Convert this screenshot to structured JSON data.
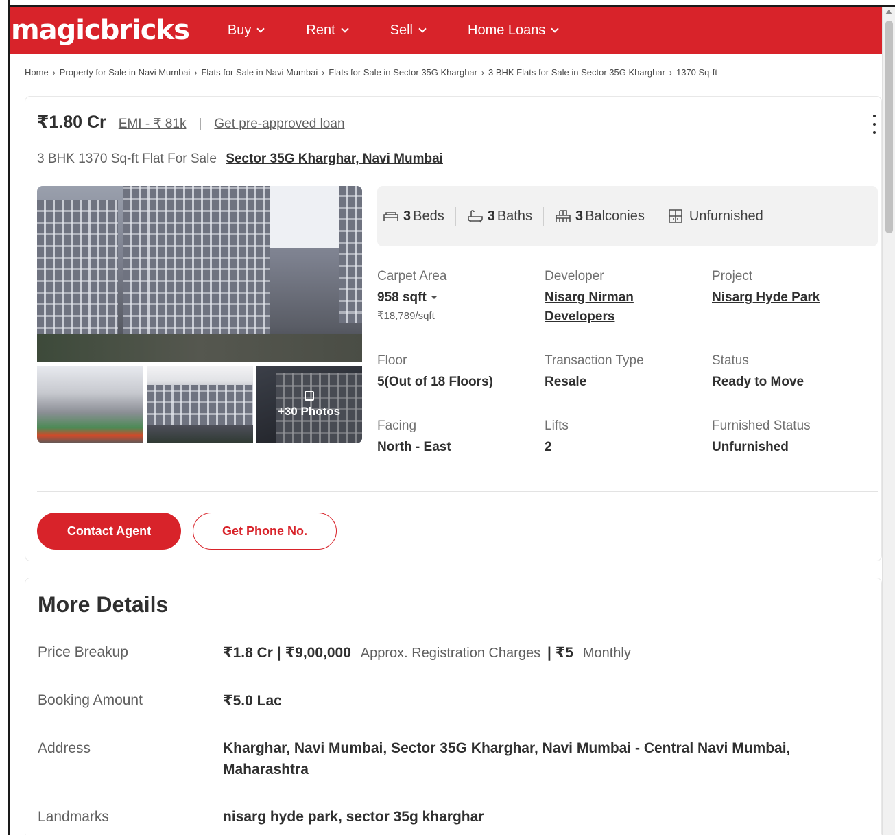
{
  "nav": {
    "logo": "magicbricks",
    "items": [
      {
        "label": "Buy"
      },
      {
        "label": "Rent"
      },
      {
        "label": "Sell"
      },
      {
        "label": "Home Loans"
      }
    ]
  },
  "breadcrumb": [
    "Home",
    "Property for Sale in Navi Mumbai",
    "Flats for Sale in Navi Mumbai",
    "Flats for Sale in Sector 35G Kharghar",
    "3 BHK Flats for Sale in Sector 35G Kharghar",
    "1370 Sq-ft"
  ],
  "listing": {
    "price": "₹1.80 Cr",
    "emi": "EMI - ₹ 81k",
    "separator": "|",
    "loan_link": "Get pre-approved loan",
    "subtitle": "3 BHK 1370 Sq-ft Flat For Sale",
    "location": "Sector 35G Kharghar, Navi Mumbai",
    "photos_more": "+30 Photos",
    "amenities": [
      {
        "count": "3",
        "label": "Beds",
        "icon": "bed-icon"
      },
      {
        "count": "3",
        "label": "Baths",
        "icon": "bathtub-icon"
      },
      {
        "count": "3",
        "label": "Balconies",
        "icon": "balcony-icon"
      },
      {
        "count": "",
        "label": "Unfurnished",
        "icon": "furniture-icon"
      }
    ],
    "summary": {
      "carpet_area_label": "Carpet Area",
      "carpet_area_value": "958 sqft",
      "carpet_area_rate": "₹18,789/sqft",
      "developer_label": "Developer",
      "developer_line1": "Nisarg Nirman",
      "developer_line2": "Developers",
      "project_label": "Project",
      "project_value": "Nisarg Hyde Park",
      "floor_label": "Floor",
      "floor_value": "5(Out of 18 Floors)",
      "transaction_label": "Transaction Type",
      "transaction_value": "Resale",
      "status_label": "Status",
      "status_value": "Ready to Move",
      "facing_label": "Facing",
      "facing_value": "North - East",
      "lifts_label": "Lifts",
      "lifts_value": "2",
      "furnished_label": "Furnished Status",
      "furnished_value": "Unfurnished"
    },
    "buttons": {
      "contact": "Contact Agent",
      "phone": "Get Phone No."
    }
  },
  "more_details": {
    "title": "More Details",
    "price_breakup_label": "Price Breakup",
    "price_breakup_value": "₹1.8 Cr | ₹9,00,000",
    "price_breakup_note": "Approx. Registration Charges",
    "price_breakup_sep": "|",
    "price_breakup_monthly_value": "₹5",
    "price_breakup_monthly": "Monthly",
    "booking_label": "Booking Amount",
    "booking_value": "₹5.0 Lac",
    "address_label": "Address",
    "address_line1": "Kharghar, Navi Mumbai, Sector 35G Kharghar, Navi Mumbai - Central Navi Mumbai,",
    "address_line2": "Maharashtra",
    "landmarks_label": "Landmarks",
    "landmarks_value": "nisarg hyde park, sector 35g kharghar"
  },
  "colors": {
    "brand": "#d8232a",
    "text": "#303030",
    "muted": "#606060"
  }
}
